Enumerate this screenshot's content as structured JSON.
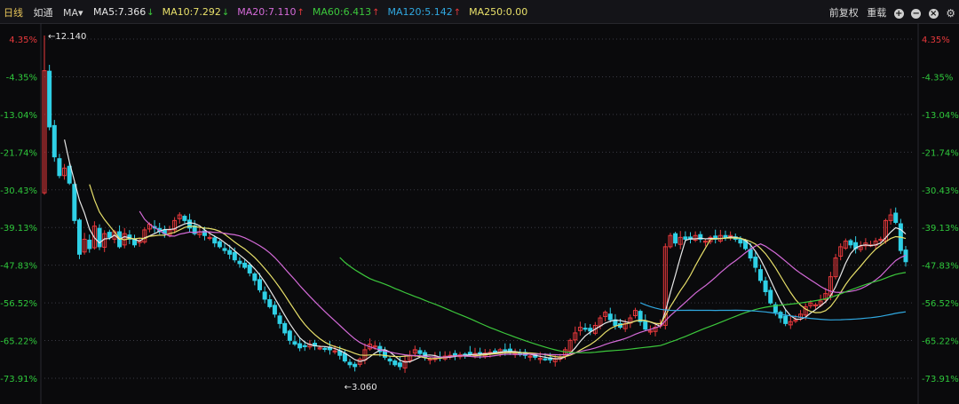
{
  "toolbar": {
    "period_tab": "日线",
    "mode_tab": "如通",
    "indicator_select": "MA",
    "ma": [
      {
        "label": "MA5:7.366",
        "dir": "down",
        "color": "#e8e8e8"
      },
      {
        "label": "MA10:7.292",
        "dir": "down",
        "color": "#e8e06a"
      },
      {
        "label": "MA20:7.110",
        "dir": "up",
        "color": "#d46ad8"
      },
      {
        "label": "MA60:6.413",
        "dir": "up",
        "color": "#3cc83c"
      },
      {
        "label": "MA120:5.142",
        "dir": "up",
        "color": "#30a8e0"
      },
      {
        "label": "MA250:0.00",
        "dir": "",
        "color": "#e8e06a"
      }
    ],
    "right_items": [
      "前复权",
      "重载"
    ],
    "arrow_up": "↑",
    "arrow_down": "↓"
  },
  "chart_data": {
    "type": "candlestick",
    "y_axis_labels": [
      "4.35%",
      "-4.35%",
      "-13.04%",
      "-21.74%",
      "-30.43%",
      "-39.13%",
      "-47.83%",
      "-56.52%",
      "-65.22%",
      "-73.91%"
    ],
    "price_range": [
      2.9,
      12.4
    ],
    "annotations": [
      {
        "text": "←12.140",
        "price": 12.14
      },
      {
        "text": "←3.060",
        "price": 3.06
      }
    ],
    "colors": {
      "up": "#e8393c",
      "down": "#2fd0e6",
      "ma5": "#e8e8e8",
      "ma10": "#e8e06a",
      "ma20": "#d46ad8",
      "ma60": "#3cc83c",
      "ma120": "#30a8e0",
      "grid": "#3a3a44"
    },
    "closes": [
      11.2,
      9.7,
      8.9,
      8.4,
      8.6,
      8.2,
      7.2,
      6.3,
      6.7,
      6.45,
      7.05,
      6.5,
      6.85,
      6.75,
      6.9,
      6.5,
      6.85,
      6.7,
      6.55,
      6.65,
      6.95,
      7.1,
      7.0,
      6.9,
      6.85,
      6.95,
      7.2,
      7.35,
      7.2,
      7.0,
      6.85,
      6.9,
      6.8,
      6.75,
      6.6,
      6.5,
      6.4,
      6.3,
      6.15,
      6.05,
      5.95,
      5.8,
      5.6,
      5.35,
      5.1,
      4.9,
      4.7,
      4.45,
      4.2,
      4.0,
      3.9,
      3.8,
      3.85,
      3.9,
      3.85,
      3.8,
      3.78,
      3.75,
      3.72,
      3.6,
      3.45,
      3.35,
      3.3,
      3.5,
      3.75,
      3.9,
      3.85,
      3.7,
      3.55,
      3.45,
      3.35,
      3.3,
      3.45,
      3.6,
      3.75,
      3.65,
      3.55,
      3.5,
      3.52,
      3.55,
      3.58,
      3.6,
      3.6,
      3.62,
      3.62,
      3.63,
      3.65,
      3.64,
      3.66,
      3.68,
      3.7,
      3.75,
      3.72,
      3.68,
      3.65,
      3.62,
      3.6,
      3.58,
      3.55,
      3.52,
      3.5,
      3.48,
      3.5,
      3.55,
      3.75,
      4.0,
      4.2,
      4.35,
      4.3,
      4.25,
      4.4,
      4.6,
      4.75,
      4.55,
      4.4,
      4.35,
      4.45,
      4.6,
      4.8,
      4.5,
      4.3,
      4.25,
      4.35,
      4.45,
      6.5,
      6.8,
      6.6,
      6.75,
      6.7,
      6.7,
      6.8,
      6.7,
      6.65,
      6.75,
      6.7,
      6.8,
      6.75,
      6.8,
      6.7,
      6.6,
      6.45,
      6.2,
      5.95,
      5.6,
      5.3,
      5.0,
      4.75,
      4.6,
      4.45,
      4.5,
      4.55,
      4.7,
      4.9,
      5.0,
      4.95,
      5.05,
      5.25,
      5.7,
      6.2,
      6.5,
      6.65,
      6.55,
      6.45,
      6.5,
      6.6,
      6.55,
      6.65,
      6.7,
      7.2,
      7.35,
      7.15,
      6.4,
      6.1
    ]
  }
}
